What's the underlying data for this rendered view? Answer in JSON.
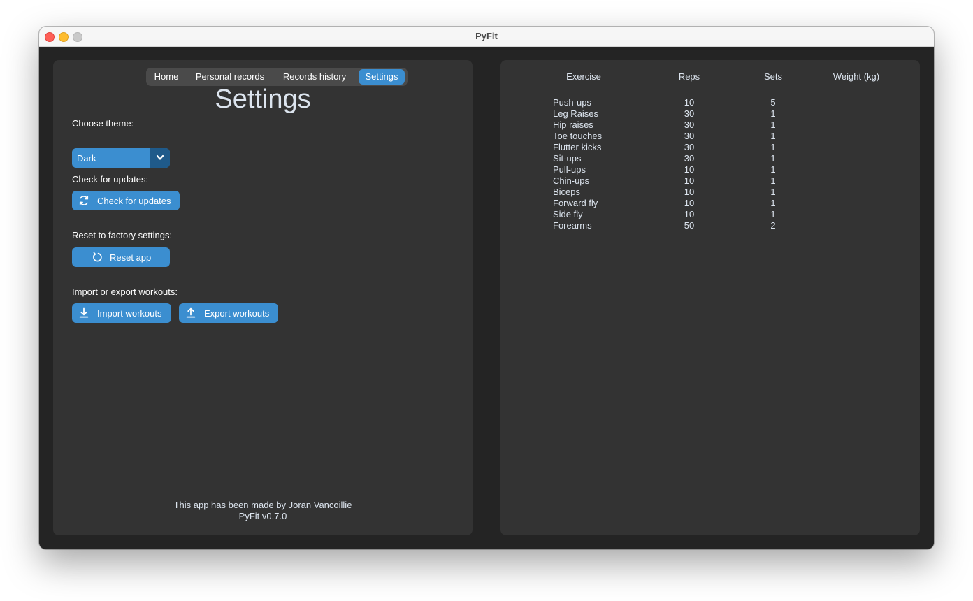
{
  "window": {
    "title": "PyFit"
  },
  "tabs": [
    {
      "label": "Home",
      "active": false
    },
    {
      "label": "Personal records",
      "active": false
    },
    {
      "label": "Records history",
      "active": false
    },
    {
      "label": "Settings",
      "active": true
    }
  ],
  "settings": {
    "title": "Settings",
    "theme_label": "Choose theme:",
    "theme_value": "Dark",
    "updates_label": "Check for updates:",
    "updates_button": "Check for updates",
    "reset_label": "Reset to factory settings:",
    "reset_button": "Reset app",
    "import_export_label": "Import or export workouts:",
    "import_button": "Import workouts",
    "export_button": "Export workouts",
    "footer_credit": "This app has been made by Joran Vancoillie",
    "footer_version": "PyFit v0.7.0"
  },
  "workout_table": {
    "columns": [
      "Exercise",
      "Reps",
      "Sets",
      "Weight (kg)"
    ],
    "rows": [
      {
        "exercise": "Push-ups",
        "reps": "10",
        "sets": "5",
        "weight": ""
      },
      {
        "exercise": "Leg Raises",
        "reps": "30",
        "sets": "1",
        "weight": ""
      },
      {
        "exercise": "Hip raises",
        "reps": "30",
        "sets": "1",
        "weight": ""
      },
      {
        "exercise": "Toe touches",
        "reps": "30",
        "sets": "1",
        "weight": ""
      },
      {
        "exercise": "Flutter kicks",
        "reps": "30",
        "sets": "1",
        "weight": ""
      },
      {
        "exercise": "Sit-ups",
        "reps": "30",
        "sets": "1",
        "weight": ""
      },
      {
        "exercise": "Pull-ups",
        "reps": "10",
        "sets": "1",
        "weight": ""
      },
      {
        "exercise": "Chin-ups",
        "reps": "10",
        "sets": "1",
        "weight": ""
      },
      {
        "exercise": "Biceps",
        "reps": "10",
        "sets": "1",
        "weight": ""
      },
      {
        "exercise": "Forward fly",
        "reps": "10",
        "sets": "1",
        "weight": ""
      },
      {
        "exercise": "Side fly",
        "reps": "10",
        "sets": "1",
        "weight": ""
      },
      {
        "exercise": "Forearms",
        "reps": "50",
        "sets": "2",
        "weight": ""
      }
    ]
  },
  "colors": {
    "accent": "#3b8ed0",
    "accent_dark": "#1f5a8a",
    "panel": "#333333",
    "background": "#242424",
    "text": "#dce4ee"
  },
  "icons": {
    "dropdown": "chevron-down-icon",
    "updates": "refresh-icon",
    "reset": "reset-icon",
    "import": "download-icon",
    "export": "upload-icon"
  }
}
